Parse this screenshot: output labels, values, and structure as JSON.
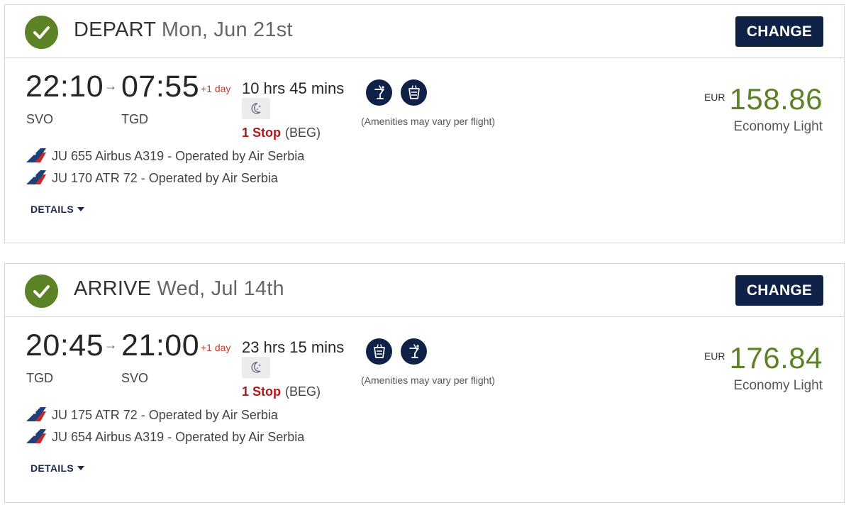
{
  "cards": [
    {
      "label": "DEPART",
      "date": "Mon, Jun 21st",
      "change_label": "CHANGE",
      "dep_time": "22:10",
      "arr_time": "07:55",
      "plus_day": "+1 day",
      "dep_iata": "SVO",
      "arr_iata": "TGD",
      "duration": "10 hrs 45 mins",
      "night_icon": "moon-stars-icon",
      "stops": "1 Stop",
      "via": "(BEG)",
      "amenities": [
        "drink-icon",
        "meal-icon"
      ],
      "amenities_note": "(Amenities may vary per flight)",
      "currency": "EUR",
      "price": "158.86",
      "fare": "Economy Light",
      "segments": [
        {
          "flight": "JU 655",
          "aircraft": "Airbus A319",
          "operator": "Operated by Air Serbia"
        },
        {
          "flight": "JU 170",
          "aircraft": "ATR 72",
          "operator": "Operated by Air Serbia"
        }
      ],
      "details_label": "DETAILS"
    },
    {
      "label": "ARRIVE",
      "date": "Wed, Jul 14th",
      "change_label": "CHANGE",
      "dep_time": "20:45",
      "arr_time": "21:00",
      "plus_day": "+1 day",
      "dep_iata": "TGD",
      "arr_iata": "SVO",
      "duration": "23 hrs 15 mins",
      "night_icon": "moon-stars-icon",
      "stops": "1 Stop",
      "via": "(BEG)",
      "amenities": [
        "meal-icon",
        "drink-icon"
      ],
      "amenities_note": "(Amenities may vary per flight)",
      "currency": "EUR",
      "price": "176.84",
      "fare": "Economy Light",
      "segments": [
        {
          "flight": "JU 175",
          "aircraft": "ATR 72",
          "operator": "Operated by Air Serbia"
        },
        {
          "flight": "JU 654",
          "aircraft": "Airbus A319",
          "operator": "Operated by Air Serbia"
        }
      ],
      "details_label": "DETAILS"
    }
  ],
  "colors": {
    "accent_green": "#5b8224",
    "navy": "#0f2147",
    "stop_red": "#b01818"
  }
}
